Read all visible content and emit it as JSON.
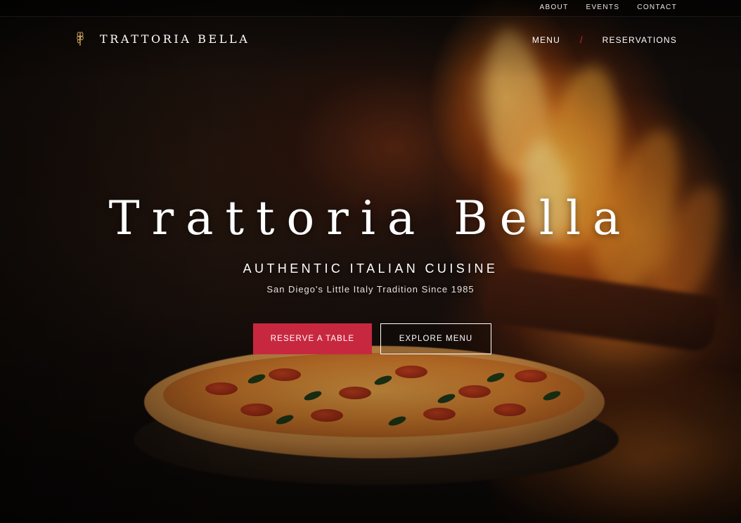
{
  "top_bar": {
    "links": [
      "ABOUT",
      "EVENTS",
      "CONTACT"
    ]
  },
  "header": {
    "brand_name": "TRATTORIA BELLA",
    "brand_icon": "wheat-icon",
    "nav": {
      "menu": "MENU",
      "separator": "/",
      "reservations": "RESERVATIONS"
    }
  },
  "hero": {
    "title": "Trattoria Bella",
    "tagline": "AUTHENTIC ITALIAN CUISINE",
    "subtitle": "San Diego's Little Italy Tradition Since 1985",
    "cta_primary": "RESERVE A TABLE",
    "cta_secondary": "EXPLORE MENU"
  },
  "colors": {
    "accent": "#c8283f",
    "text": "#ffffff"
  }
}
